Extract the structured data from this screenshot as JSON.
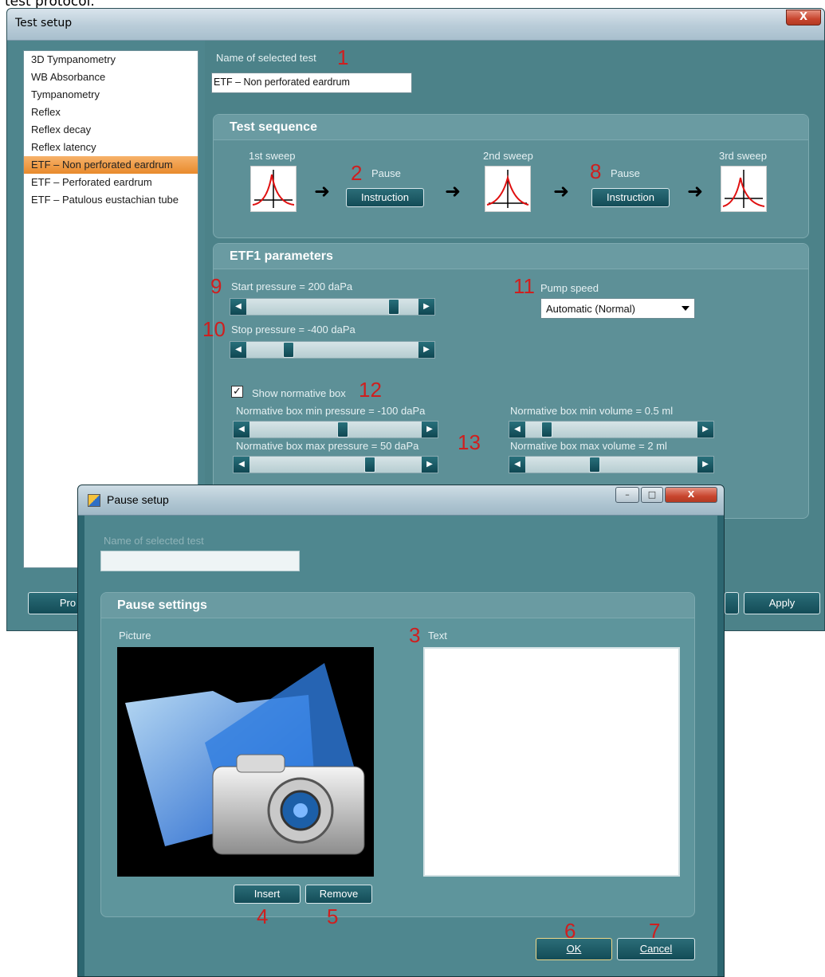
{
  "caption": "test protocol.",
  "main_window": {
    "title": "Test setup",
    "close_label": "X",
    "test_list": [
      "3D Tympanometry",
      "WB Absorbance",
      "Tympanometry",
      "Reflex",
      "Reflex decay",
      "Reflex latency",
      "ETF – Non perforated eardrum",
      "ETF – Perforated eardrum",
      "ETF – Patulous eustachian tube"
    ],
    "selected_index": 6,
    "name_label": "Name of selected test",
    "name_value": "ETF – Non perforated eardrum",
    "test_sequence": {
      "title": "Test sequence",
      "sweep1": "1st sweep",
      "sweep2": "2nd sweep",
      "sweep3": "3rd sweep",
      "pause1_label": "Pause",
      "pause2_label": "Pause",
      "instruction1": "Instruction",
      "instruction2": "Instruction"
    },
    "parameters": {
      "title": "ETF1 parameters",
      "start_pressure": "Start pressure = 200 daPa",
      "stop_pressure": "Stop pressure = -400 daPa",
      "pump_speed_label": "Pump speed",
      "pump_speed_value": "Automatic (Normal)",
      "show_normative_box": "Show normative box",
      "show_normative_checked": true,
      "norm_min_pressure": "Normative box min pressure = -100 daPa",
      "norm_max_pressure": "Normative box max pressure = 50 daPa",
      "norm_min_volume": "Normative box min volume = 0.5 ml",
      "norm_max_volume": "Normative box max volume = 2 ml"
    },
    "bottom_buttons": {
      "left_partial": "Pro",
      "apply": "Apply"
    }
  },
  "pause_window": {
    "title": "Pause setup",
    "win_min": "–",
    "win_max": "□",
    "win_close": "X",
    "name_label": "Name of selected test",
    "name_value": "",
    "settings_title": "Pause settings",
    "picture_label": "Picture",
    "text_label": "Text",
    "insert": "Insert",
    "remove": "Remove",
    "ok": "OK",
    "cancel": "Cancel"
  },
  "annotations": [
    "1",
    "2",
    "3",
    "4",
    "5",
    "6",
    "7",
    "8",
    "9",
    "10",
    "11",
    "12",
    "13"
  ],
  "colors": {
    "accent_selected": "#e88a2c",
    "annotation": "#cf1f1f",
    "panel": "#4c8289"
  }
}
